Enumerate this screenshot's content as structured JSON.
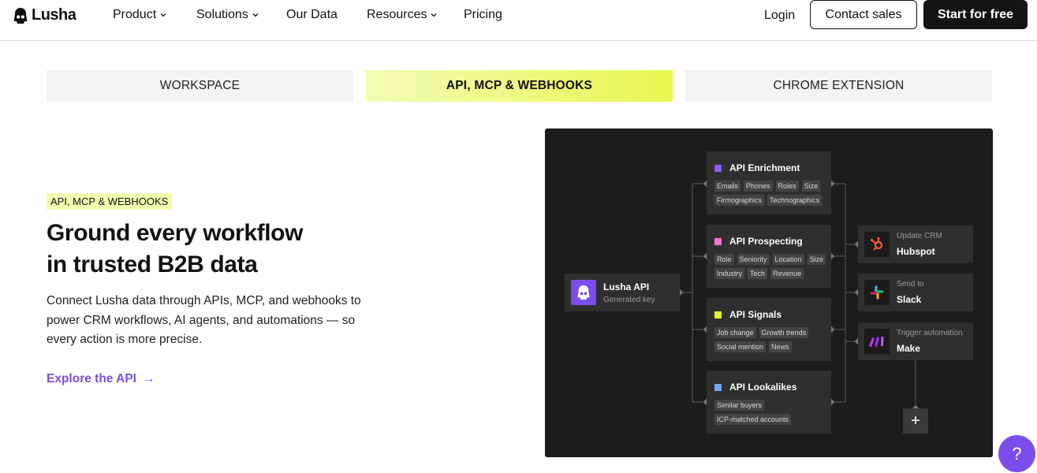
{
  "nav": {
    "logo": "Lusha",
    "items": [
      {
        "label": "Product",
        "dropdown": true
      },
      {
        "label": "Solutions",
        "dropdown": true
      },
      {
        "label": "Our Data",
        "dropdown": false
      },
      {
        "label": "Resources",
        "dropdown": true
      },
      {
        "label": "Pricing",
        "dropdown": false
      }
    ],
    "login": "Login",
    "contact_sales": "Contact sales",
    "start_free": "Start for free"
  },
  "tabs": [
    {
      "label": "WORKSPACE",
      "active": false
    },
    {
      "label": "API, MCP & WEBHOOKS",
      "active": true
    },
    {
      "label": "CHROME EXTENSION",
      "active": false
    }
  ],
  "hero": {
    "pill": "API, MCP & WEBHOOKS",
    "headline_line1": "Ground every workflow",
    "headline_line2": "in trusted B2B data",
    "description": "Connect Lusha data through APIs, MCP, and webhooks to power CRM workflows, AI agents, and automations — so every action is more precise.",
    "cta": "Explore the API",
    "cta_arrow": "→"
  },
  "diagram": {
    "source": {
      "title": "Lusha API",
      "subtitle": "Generated key"
    },
    "apis": [
      {
        "title": "API Enrichment",
        "color": "#8b5cf6",
        "chips": [
          "Emails",
          "Phones",
          "Roles",
          "Size",
          "Firmographics",
          "Technographics"
        ]
      },
      {
        "title": "API Prospecting",
        "color": "#f472d0",
        "chips": [
          "Role",
          "Seniority",
          "Location",
          "Size",
          "Industry",
          "Tech",
          "Revenue"
        ]
      },
      {
        "title": "API Signals",
        "color": "#e6f51f",
        "chips": [
          "Job change",
          "Growth trends",
          "Social mention",
          "News"
        ]
      },
      {
        "title": "API Lookalikes",
        "color": "#6ea8f7",
        "chips": [
          "Similar buyers",
          "ICP-matched accounts"
        ]
      }
    ],
    "destinations": [
      {
        "sub": "Update CRM",
        "title": "Hubspot",
        "icon": "hubspot-icon"
      },
      {
        "sub": "Send to",
        "title": "Slack",
        "icon": "slack-icon"
      },
      {
        "sub": "Trigger automation",
        "title": "Make",
        "icon": "make-icon"
      }
    ],
    "plus": "+"
  },
  "help": "?",
  "colors": {
    "accent": "#7c4dea",
    "tab_active_start": "#f3fdb4",
    "tab_active_end": "#e4f74f",
    "panel": "#1c1c1c"
  }
}
